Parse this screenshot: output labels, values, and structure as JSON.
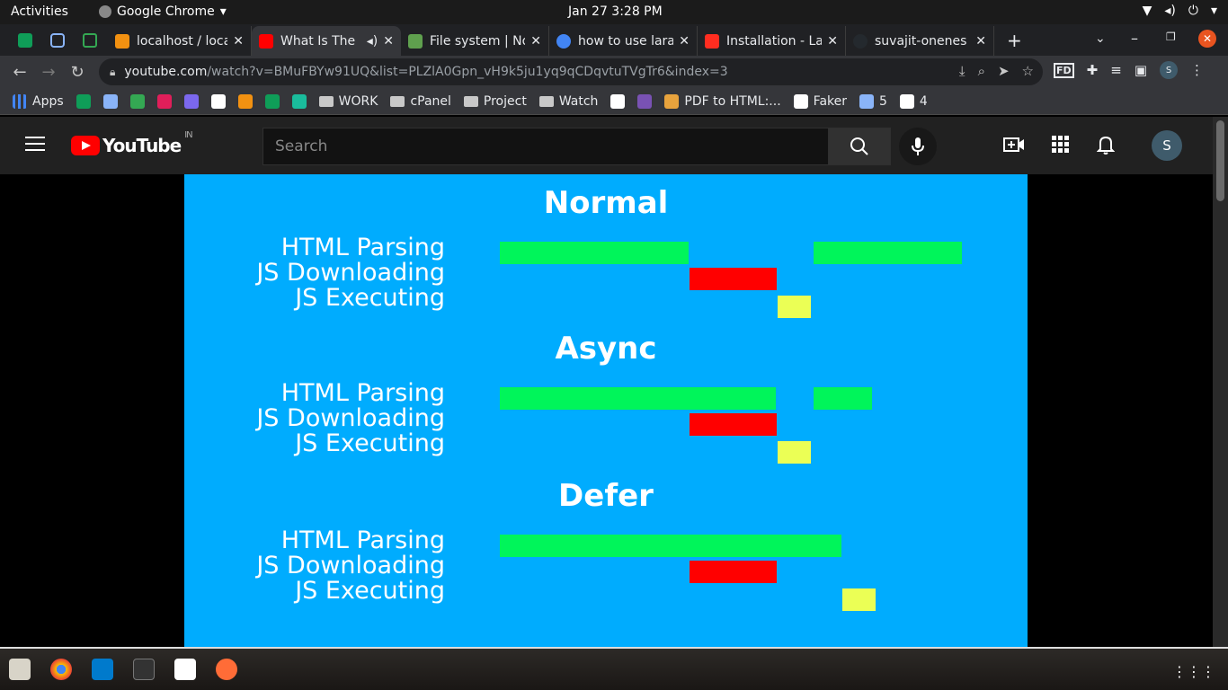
{
  "os_bar": {
    "activities": "Activities",
    "app_name": "Google Chrome",
    "clock": "Jan 27   3:28 PM"
  },
  "tabs": [
    {
      "title": "localhost / loca",
      "favicon_color": "#f29111",
      "active": false
    },
    {
      "title": "What Is The",
      "favicon_color": "#ff0000",
      "active": true
    },
    {
      "title": "File system | No",
      "favicon_color": "#5fa04e",
      "active": false
    },
    {
      "title": "how to use lara",
      "favicon_color": "#4285f4",
      "active": false
    },
    {
      "title": "Installation - La",
      "favicon_color": "#ff2d20",
      "active": false
    },
    {
      "title": "suvajit-onenes",
      "favicon_color": "#24292e",
      "active": false
    }
  ],
  "address_bar": {
    "host": "youtube.com",
    "path": "/watch?v=BMuFBYw91UQ&list=PLZlA0Gpn_vH9k5ju1yq9qCDqvtuTVgTr6&index=3"
  },
  "bookmarks": [
    {
      "label": "Apps",
      "icon": "apps-grid-icon",
      "color": "#4285f4"
    },
    {
      "label": "",
      "icon": "sheets-icon",
      "color": "#0f9d58"
    },
    {
      "label": "",
      "icon": "mail-icon",
      "color": "#8ab4f8"
    },
    {
      "label": "",
      "icon": "task-icon",
      "color": "#34a853"
    },
    {
      "label": "",
      "icon": "slack-icon",
      "color": "#e01e5a"
    },
    {
      "label": "",
      "icon": "clickup-icon",
      "color": "#7b68ee"
    },
    {
      "label": "",
      "icon": "github-icon",
      "color": "#ffffff"
    },
    {
      "label": "",
      "icon": "pma-icon",
      "color": "#f29111"
    },
    {
      "label": "",
      "icon": "d-icon",
      "color": "#0f9d58"
    },
    {
      "label": "",
      "icon": "pocket-icon",
      "color": "#1abc9c"
    },
    {
      "label": "WORK",
      "icon": "folder-icon",
      "color": "#c8c8c8"
    },
    {
      "label": "cPanel",
      "icon": "folder-icon",
      "color": "#c8c8c8"
    },
    {
      "label": "Project",
      "icon": "folder-icon",
      "color": "#c8c8c8"
    },
    {
      "label": "Watch",
      "icon": "folder-icon",
      "color": "#c8c8c8"
    },
    {
      "label": "",
      "icon": "l-icon",
      "color": "#ffffff"
    },
    {
      "label": "",
      "icon": "bootstrap-icon",
      "color": "#7952b3"
    },
    {
      "label": "PDF to HTML:...",
      "icon": "pdf-icon",
      "color": "#e8a33d"
    },
    {
      "label": "Faker",
      "icon": "github-icon",
      "color": "#ffffff"
    },
    {
      "label": "5",
      "icon": "flag-icon",
      "color": "#8ab4f8"
    },
    {
      "label": "4",
      "icon": "image-icon",
      "color": "#ffffff"
    }
  ],
  "youtube": {
    "logo_text": "YouTube",
    "country_code": "IN",
    "search_placeholder": "Search",
    "avatar_letter": "S"
  },
  "video": {
    "sections": [
      {
        "title": "Normal",
        "rows": [
          "HTML Parsing",
          "JS Downloading",
          "JS Executing"
        ]
      },
      {
        "title": "Async",
        "rows": [
          "HTML Parsing",
          "JS Downloading",
          "JS Executing"
        ]
      },
      {
        "title": "Defer",
        "rows": [
          "HTML Parsing",
          "JS Downloading",
          "JS Executing"
        ]
      }
    ],
    "colors": {
      "parsing": "#00f55a",
      "downloading": "#ff0000",
      "executing": "#ebff55",
      "background": "#00acfe"
    }
  }
}
